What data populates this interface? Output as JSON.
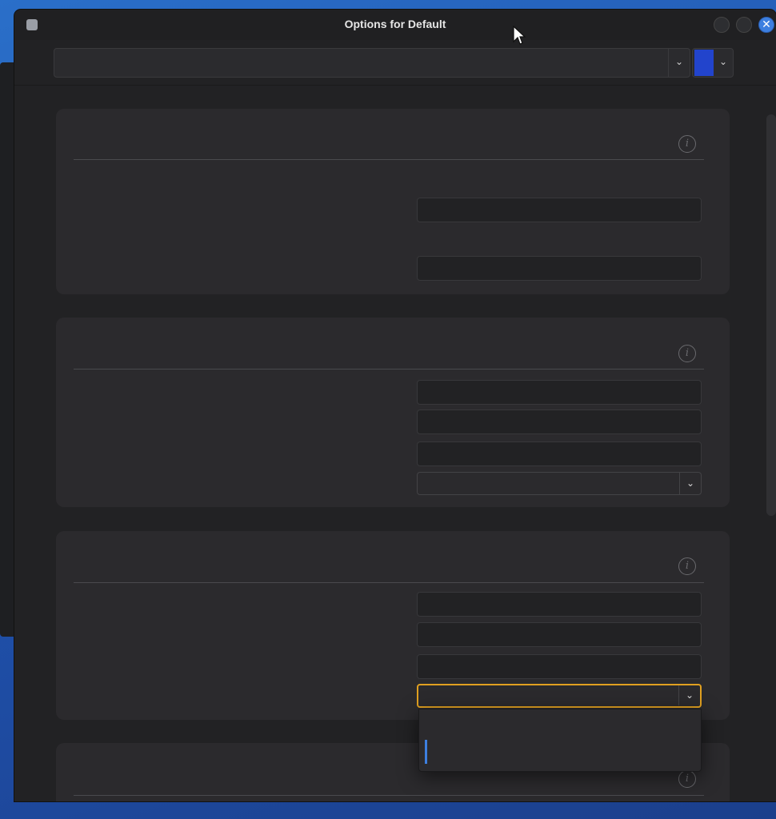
{
  "window": {
    "title": "Options for Default"
  },
  "titlebar": {
    "app_icon": "terminal-app-icon",
    "buttons": [
      {
        "name": "minimize-button",
        "icon": "minimize-icon"
      },
      {
        "name": "maximize-button",
        "icon": "maximize-icon"
      },
      {
        "name": "close-button",
        "icon": "close-icon",
        "glyph": "✕"
      }
    ]
  },
  "toolbar": {
    "profile_combo_value": "",
    "profile_combo_arrow": "⌄",
    "color_swatch": "#2244cc",
    "color_arrow": "⌄"
  },
  "sections": [
    {
      "name": "section-1",
      "info_glyph": "i",
      "fields": 2,
      "combos": 0
    },
    {
      "name": "section-2",
      "info_glyph": "i",
      "fields": 3,
      "combos": 1
    },
    {
      "name": "section-3",
      "info_glyph": "i",
      "fields": 3,
      "combos": 1,
      "focused_combo": true
    },
    {
      "name": "section-4",
      "info_glyph": "i"
    }
  ],
  "colors": {
    "accent": "#3d7fe0",
    "focus_border": "#e0a020",
    "window_bg": "#232325",
    "card_bg": "#2b2a2d"
  }
}
